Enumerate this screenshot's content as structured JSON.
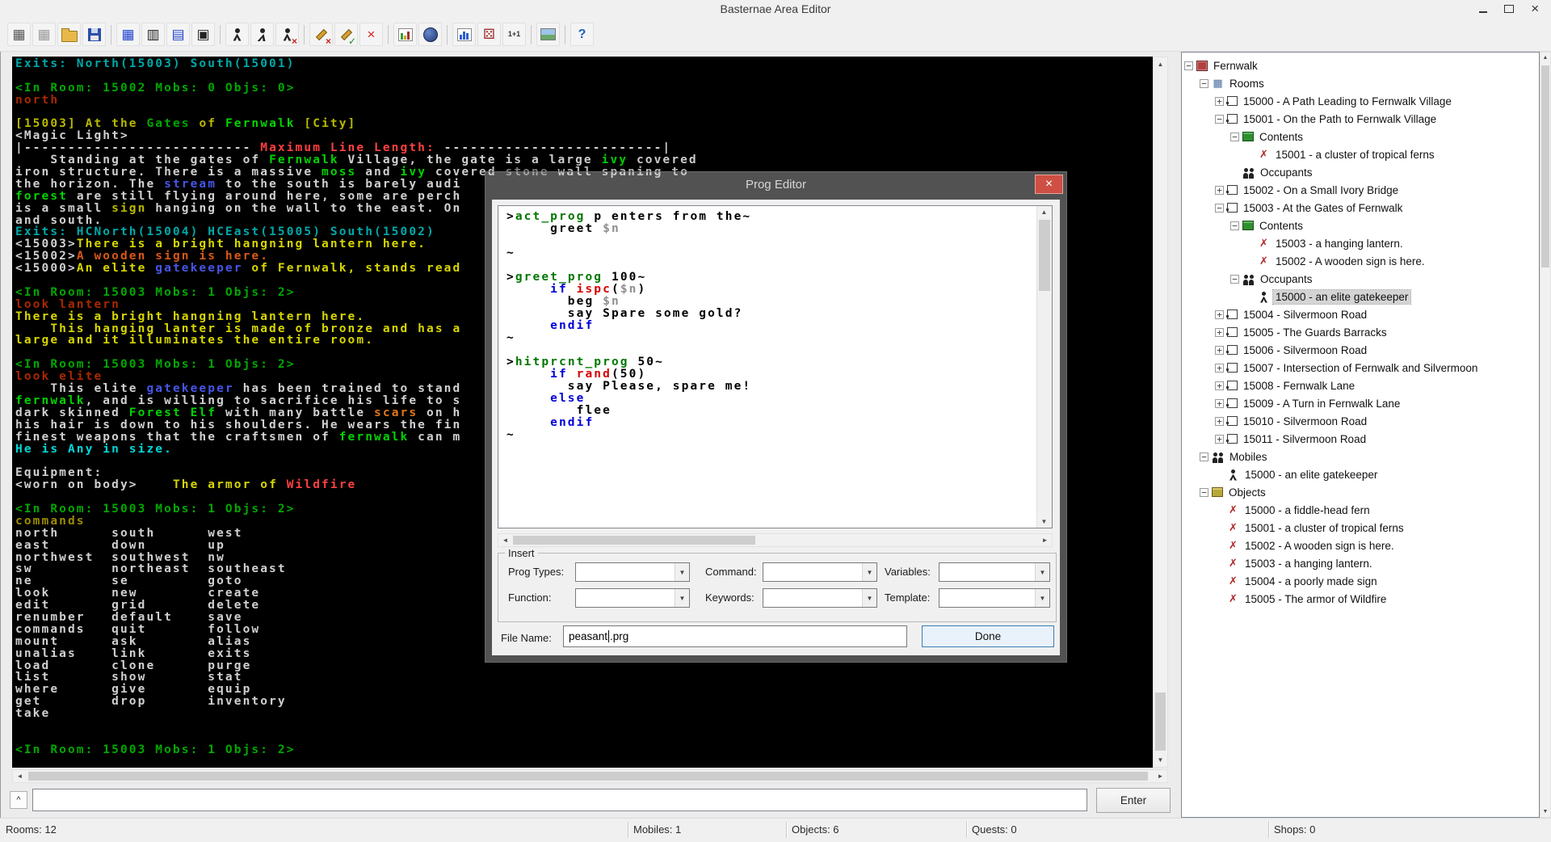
{
  "window": {
    "title": "Basternae Area Editor",
    "close_glyph": "×"
  },
  "palette": {
    "g": "#00a800",
    "G": "#00d400",
    "c": "#00a8a8",
    "C": "#00d8d8",
    "y": "#b8b800",
    "Y": "#d6d600",
    "r": "#a82800",
    "R": "#ff4040",
    "w": "#d0d0d0",
    "d": "#8f8f8f",
    "b": "#4656e8",
    "o": "#e07818",
    "O": "#d85818",
    "dy": "#9c8c00"
  },
  "toolbar": {
    "groups": [
      {
        "icons": [
          {
            "name": "new-area-icon",
            "glyph": "▦",
            "color": "#555555"
          },
          {
            "name": "new-window-icon",
            "glyph": "▦",
            "color": "#9a9a9a"
          },
          {
            "name": "open-file-icon",
            "cls": "ic-folder"
          },
          {
            "name": "save-icon",
            "cls": "ic-floppy"
          }
        ]
      },
      {
        "icons": [
          {
            "name": "room-add-icon",
            "glyph": "▦",
            "color": "#2244cc"
          },
          {
            "name": "room-edit-icon",
            "glyph": "▥",
            "color": "#222222"
          },
          {
            "name": "room-link-icon",
            "glyph": "▤",
            "color": "#2244cc"
          },
          {
            "name": "room-grid-icon",
            "glyph": "▣",
            "color": "#222222"
          }
        ]
      },
      {
        "icons": [
          {
            "name": "mobile-icon",
            "cls": "ic-man"
          },
          {
            "name": "mobile-move-icon",
            "cls": "ic-man ic-run"
          },
          {
            "name": "mobile-delete-icon",
            "cls": "ic-man",
            "overlay": "×",
            "overlay_color": "#cc2020"
          }
        ]
      },
      {
        "icons": [
          {
            "name": "prog-delete-icon",
            "cls": "ic-pencil",
            "overlay": "×",
            "overlay_color": "#cc2020"
          },
          {
            "name": "prog-check-icon",
            "cls": "ic-pencil",
            "overlay": "✓",
            "overlay_color": "#1a8a1a"
          },
          {
            "name": "delete-icon",
            "glyph": "×",
            "color": "#cc2020"
          }
        ]
      },
      {
        "icons": [
          {
            "name": "chart-icon",
            "cls": "ic-chart"
          },
          {
            "name": "world-icon",
            "cls": "ic-globe"
          }
        ]
      },
      {
        "icons": [
          {
            "name": "stats-icon",
            "cls": "ic-bars"
          },
          {
            "name": "dice-icon",
            "glyph": "⚄",
            "color": "#a03030"
          },
          {
            "name": "calc-icon",
            "glyph": "1+1",
            "cls": "ic-text",
            "color": "#333333"
          }
        ]
      },
      {
        "icons": [
          {
            "name": "image-icon",
            "cls": "ic-image"
          }
        ]
      },
      {
        "icons": [
          {
            "name": "help-icon",
            "glyph": "?",
            "cls": "ic-help",
            "color": "#2060c0"
          }
        ]
      }
    ]
  },
  "terminal": {
    "lines": [
      [
        {
          "c": "c",
          "t": "Exits: North(15003) South(15001)"
        }
      ],
      [],
      [
        {
          "c": "g",
          "t": "<In Room: 15002 Mobs: 0 Objs: 0>"
        }
      ],
      [
        {
          "c": "r",
          "t": "north"
        }
      ],
      [],
      [
        {
          "c": "y",
          "t": "[15003] At the "
        },
        {
          "c": "g",
          "t": "Gates"
        },
        {
          "c": "y",
          "t": " of "
        },
        {
          "c": "G",
          "t": "Fernwalk"
        },
        {
          "c": "y",
          "t": " [City]"
        }
      ],
      [
        {
          "c": "w",
          "t": "<Magic Light>"
        }
      ],
      [
        {
          "c": "w",
          "t": "|--------------------------"
        },
        {
          "c": "R",
          "t": " Maximum Line Length: "
        },
        {
          "c": "w",
          "t": "-------------------------|"
        }
      ],
      [
        {
          "c": "w",
          "t": "    Standing at the gates of "
        },
        {
          "c": "G",
          "t": "Fernwalk"
        },
        {
          "c": "w",
          "t": " Village, the gate is a large "
        },
        {
          "c": "G",
          "t": "ivy"
        },
        {
          "c": "w",
          "t": " covered"
        }
      ],
      [
        {
          "c": "w",
          "t": "iron structure. There is a massive "
        },
        {
          "c": "G",
          "t": "moss"
        },
        {
          "c": "w",
          "t": " and "
        },
        {
          "c": "G",
          "t": "ivy"
        },
        {
          "c": "w",
          "t": " covered "
        },
        {
          "c": "d",
          "t": "stone"
        },
        {
          "c": "w",
          "t": " wall spaning to"
        }
      ],
      [
        {
          "c": "w",
          "t": "the horizon. The "
        },
        {
          "c": "b",
          "t": "stream"
        },
        {
          "c": "w",
          "t": " to the south is barely audi"
        }
      ],
      [
        {
          "c": "G",
          "t": "forest"
        },
        {
          "c": "w",
          "t": " are still flying around here, some are perch"
        }
      ],
      [
        {
          "c": "w",
          "t": "is a small "
        },
        {
          "c": "y",
          "t": "sign"
        },
        {
          "c": "w",
          "t": " hanging on the wall to the east. On"
        }
      ],
      [
        {
          "c": "w",
          "t": "and south."
        }
      ],
      [
        {
          "c": "c",
          "t": "Exits: HCNorth(15004) HCEast(15005) South(15002)"
        }
      ],
      [
        {
          "c": "w",
          "t": "<15003>"
        },
        {
          "c": "Y",
          "t": "There is a bright hangning lantern here."
        }
      ],
      [
        {
          "c": "w",
          "t": "<15002>"
        },
        {
          "c": "O",
          "t": "A wooden sign is here."
        }
      ],
      [
        {
          "c": "w",
          "t": "<15000>"
        },
        {
          "c": "Y",
          "t": "An elite "
        },
        {
          "c": "b",
          "t": "gatekeeper"
        },
        {
          "c": "Y",
          "t": " of Fernwalk, stands read"
        }
      ],
      [],
      [
        {
          "c": "g",
          "t": "<In Room: 15003 Mobs: 1 Objs: 2>"
        }
      ],
      [
        {
          "c": "r",
          "t": "look lantern"
        }
      ],
      [
        {
          "c": "Y",
          "t": "There is a bright hangning lantern here."
        }
      ],
      [
        {
          "c": "Y",
          "t": "    This hanging lanter is made of bronze and has a"
        }
      ],
      [
        {
          "c": "Y",
          "t": "large and it illuminates the entire room."
        }
      ],
      [],
      [
        {
          "c": "g",
          "t": "<In Room: 15003 Mobs: 1 Objs: 2>"
        }
      ],
      [
        {
          "c": "r",
          "t": "look elite"
        }
      ],
      [
        {
          "c": "w",
          "t": "    This elite "
        },
        {
          "c": "b",
          "t": "gatekeeper"
        },
        {
          "c": "w",
          "t": " has been trained to stand"
        }
      ],
      [
        {
          "c": "G",
          "t": "fernwalk"
        },
        {
          "c": "w",
          "t": ", and is willing to sacrifice his life to s"
        }
      ],
      [
        {
          "c": "w",
          "t": "dark skinned "
        },
        {
          "c": "G",
          "t": "Forest Elf"
        },
        {
          "c": "w",
          "t": " with many battle "
        },
        {
          "c": "o",
          "t": "scars"
        },
        {
          "c": "w",
          "t": " on h"
        }
      ],
      [
        {
          "c": "w",
          "t": "his hair is down to his shoulders. He wears the fin"
        }
      ],
      [
        {
          "c": "w",
          "t": "finest weapons that the craftsmen of "
        },
        {
          "c": "G",
          "t": "fernwalk"
        },
        {
          "c": "w",
          "t": " can m"
        }
      ],
      [
        {
          "c": "C",
          "t": "He is Any in size."
        }
      ],
      [],
      [
        {
          "c": "w",
          "t": "Equipment:"
        }
      ],
      [
        {
          "c": "w",
          "t": "<worn on body>    "
        },
        {
          "c": "Y",
          "t": "The armor of "
        },
        {
          "c": "R",
          "t": "Wildfire"
        }
      ],
      [],
      [
        {
          "c": "g",
          "t": "<In Room: 15003 Mobs: 1 Objs: 2>"
        }
      ],
      [
        {
          "c": "dy",
          "t": "commands"
        }
      ],
      [
        {
          "c": "w",
          "t": "north      south      west"
        }
      ],
      [
        {
          "c": "w",
          "t": "east       down       up"
        }
      ],
      [
        {
          "c": "w",
          "t": "northwest  southwest  nw"
        }
      ],
      [
        {
          "c": "w",
          "t": "sw         northeast  southeast"
        }
      ],
      [
        {
          "c": "w",
          "t": "ne         se         goto"
        }
      ],
      [
        {
          "c": "w",
          "t": "look       new        create"
        }
      ],
      [
        {
          "c": "w",
          "t": "edit       grid       delete"
        }
      ],
      [
        {
          "c": "w",
          "t": "renumber   default    save"
        }
      ],
      [
        {
          "c": "w",
          "t": "commands   quit       follow"
        }
      ],
      [
        {
          "c": "w",
          "t": "mount      ask        alias"
        }
      ],
      [
        {
          "c": "w",
          "t": "unalias    link       exits"
        }
      ],
      [
        {
          "c": "w",
          "t": "load       clone      purge"
        }
      ],
      [
        {
          "c": "w",
          "t": "list       show       stat"
        }
      ],
      [
        {
          "c": "w",
          "t": "where      give       equip"
        }
      ],
      [
        {
          "c": "w",
          "t": "get        drop       inventory"
        }
      ],
      [
        {
          "c": "w",
          "t": "take"
        }
      ],
      [],
      [],
      [
        {
          "c": "g",
          "t": "<In Room: 15003 Mobs: 1 Objs: 2>"
        }
      ]
    ]
  },
  "prog_editor": {
    "title": "Prog Editor",
    "insert_label": "Insert",
    "labels": {
      "prog_types": "Prog Types:",
      "command": "Command:",
      "variables": "Variables:",
      "function": "Function:",
      "keywords": "Keywords:",
      "template": "Template:",
      "file_name": "File Name:"
    },
    "file_name": {
      "value": "peasant.prg",
      "before_caret": "peasant",
      "after_caret": ".prg"
    },
    "done_label": "Done",
    "code_palette": {
      "k": "#000000",
      "g": "#007800",
      "b": "#0000d8",
      "r": "#d80000",
      "v": "#8f8f8f"
    },
    "code_lines": [
      [
        {
          "c": "k",
          "t": ">"
        },
        {
          "c": "g",
          "t": "act_prog"
        },
        {
          "c": "k",
          "t": " p enters from the~"
        }
      ],
      [
        {
          "c": "k",
          "t": "     greet "
        },
        {
          "c": "v",
          "t": "$n"
        }
      ],
      [],
      [
        {
          "c": "k",
          "t": "~"
        }
      ],
      [],
      [
        {
          "c": "k",
          "t": ">"
        },
        {
          "c": "g",
          "t": "greet_prog"
        },
        {
          "c": "k",
          "t": " 100~"
        }
      ],
      [
        {
          "c": "b",
          "t": "     if "
        },
        {
          "c": "r",
          "t": "ispc"
        },
        {
          "c": "k",
          "t": "("
        },
        {
          "c": "v",
          "t": "$n"
        },
        {
          "c": "k",
          "t": ")"
        }
      ],
      [
        {
          "c": "k",
          "t": "       beg "
        },
        {
          "c": "v",
          "t": "$n"
        }
      ],
      [
        {
          "c": "k",
          "t": "       say Spare some gold?"
        }
      ],
      [
        {
          "c": "b",
          "t": "     endif"
        }
      ],
      [
        {
          "c": "k",
          "t": "~"
        }
      ],
      [],
      [
        {
          "c": "k",
          "t": ">"
        },
        {
          "c": "g",
          "t": "hitprcnt_prog"
        },
        {
          "c": "k",
          "t": " 50~"
        }
      ],
      [
        {
          "c": "b",
          "t": "     if "
        },
        {
          "c": "r",
          "t": "rand"
        },
        {
          "c": "k",
          "t": "(50)"
        }
      ],
      [
        {
          "c": "k",
          "t": "       say Please, spare me!"
        }
      ],
      [
        {
          "c": "b",
          "t": "     else"
        }
      ],
      [
        {
          "c": "k",
          "t": "        flee"
        }
      ],
      [
        {
          "c": "b",
          "t": "     endif"
        }
      ],
      [
        {
          "c": "k",
          "t": "~"
        }
      ]
    ]
  },
  "tree": {
    "icon_defs": {
      "area": {
        "cls": "tic-area"
      },
      "rooms": {
        "glyph": "▦",
        "color": "#4a6da0"
      },
      "room": {
        "cls": "tic-room"
      },
      "contents": {
        "cls": "tic-boxg"
      },
      "occupants": {
        "cls": "tic-people"
      },
      "mobiles": {
        "cls": "tic-people"
      },
      "objects": {
        "cls": "tic-boxo"
      },
      "obj": {
        "glyph": "✗",
        "color": "#b02828"
      },
      "person": {
        "cls": "tic-man2"
      }
    },
    "items": [
      {
        "lvl": 0,
        "exp": "-",
        "icon": "area",
        "label": "Fernwalk"
      },
      {
        "lvl": 1,
        "exp": "-",
        "icon": "rooms",
        "label": "Rooms"
      },
      {
        "lvl": 2,
        "exp": "+",
        "icon": "room",
        "label": "15000 - A Path Leading to Fernwalk Village"
      },
      {
        "lvl": 2,
        "exp": "-",
        "icon": "room",
        "label": "15001 - On the Path to Fernwalk Village"
      },
      {
        "lvl": 3,
        "exp": "-",
        "icon": "contents",
        "label": "Contents"
      },
      {
        "lvl": 4,
        "exp": null,
        "icon": "obj",
        "label": "15001 - a cluster of tropical ferns"
      },
      {
        "lvl": 3,
        "exp": null,
        "icon": "occupants",
        "label": "Occupants"
      },
      {
        "lvl": 2,
        "exp": "+",
        "icon": "room",
        "label": "15002 - On a Small Ivory Bridge"
      },
      {
        "lvl": 2,
        "exp": "-",
        "icon": "room",
        "label": "15003 - At the Gates of Fernwalk"
      },
      {
        "lvl": 3,
        "exp": "-",
        "icon": "contents",
        "label": "Contents"
      },
      {
        "lvl": 4,
        "exp": null,
        "icon": "obj",
        "label": "15003 - a hanging lantern."
      },
      {
        "lvl": 4,
        "exp": null,
        "icon": "obj",
        "label": "15002 - A wooden sign is here."
      },
      {
        "lvl": 3,
        "exp": "-",
        "icon": "occupants",
        "label": "Occupants"
      },
      {
        "lvl": 4,
        "exp": null,
        "icon": "person",
        "label": "15000 - an elite gatekeeper",
        "sel": true
      },
      {
        "lvl": 2,
        "exp": "+",
        "icon": "room",
        "label": "15004 - Silvermoon Road"
      },
      {
        "lvl": 2,
        "exp": "+",
        "icon": "room",
        "label": "15005 - The Guards Barracks"
      },
      {
        "lvl": 2,
        "exp": "+",
        "icon": "room",
        "label": "15006 - Silvermoon Road"
      },
      {
        "lvl": 2,
        "exp": "+",
        "icon": "room",
        "label": "15007 - Intersection of Fernwalk and Silvermoon"
      },
      {
        "lvl": 2,
        "exp": "+",
        "icon": "room",
        "label": "15008 - Fernwalk Lane"
      },
      {
        "lvl": 2,
        "exp": "+",
        "icon": "room",
        "label": "15009 - A Turn in Fernwalk Lane"
      },
      {
        "lvl": 2,
        "exp": "+",
        "icon": "room",
        "label": "15010 - Silvermoon Road"
      },
      {
        "lvl": 2,
        "exp": "+",
        "icon": "room",
        "label": "15011 - Silvermoon Road"
      },
      {
        "lvl": 1,
        "exp": "-",
        "icon": "mobiles",
        "label": "Mobiles"
      },
      {
        "lvl": 2,
        "exp": null,
        "icon": "person",
        "label": "15000 - an elite gatekeeper"
      },
      {
        "lvl": 1,
        "exp": "-",
        "icon": "objects",
        "label": "Objects"
      },
      {
        "lvl": 2,
        "exp": null,
        "icon": "obj",
        "label": "15000 - a fiddle-head fern"
      },
      {
        "lvl": 2,
        "exp": null,
        "icon": "obj",
        "label": "15001 - a cluster of tropical ferns"
      },
      {
        "lvl": 2,
        "exp": null,
        "icon": "obj",
        "label": "15002 - A wooden sign is here."
      },
      {
        "lvl": 2,
        "exp": null,
        "icon": "obj",
        "label": "15003 - a hanging lantern."
      },
      {
        "lvl": 2,
        "exp": null,
        "icon": "obj",
        "label": "15004 - a poorly made sign"
      },
      {
        "lvl": 2,
        "exp": null,
        "icon": "obj",
        "label": "15005 - The armor of Wildfire"
      }
    ]
  },
  "command_bar": {
    "history_glyph": "^",
    "input_value": "",
    "enter_label": "Enter"
  },
  "status_bar": {
    "rooms": "Rooms: 12",
    "mobiles": "Mobiles: 1",
    "objects": "Objects: 6",
    "quests": "Quests: 0",
    "shops": "Shops: 0"
  }
}
